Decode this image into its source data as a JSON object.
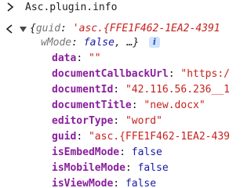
{
  "console": {
    "input": "Asc.plugin.info",
    "preview_line1": {
      "open": "{",
      "key1": "guid",
      "sep1": ": ",
      "val1": "'asc.{FFE1F462-1EA2-4391"
    },
    "preview_line2": {
      "key2": "wMode",
      "sep2": ": ",
      "val2": "false",
      "tail": ", …}"
    },
    "info_badge": "i",
    "properties": [
      {
        "key": "data",
        "sep": ": ",
        "value": "\"\"",
        "kind": "string"
      },
      {
        "key": "documentCallbackUrl",
        "sep": ": ",
        "value": "\"https:/",
        "kind": "string"
      },
      {
        "key": "documentId",
        "sep": ": ",
        "value": "\"42.116.56.236__1",
        "kind": "string"
      },
      {
        "key": "documentTitle",
        "sep": ": ",
        "value": "\"new.docx\"",
        "kind": "string"
      },
      {
        "key": "editorType",
        "sep": ": ",
        "value": "\"word\"",
        "kind": "string"
      },
      {
        "key": "guid",
        "sep": ": ",
        "value": "\"asc.{FFE1F462-1EA2-439",
        "kind": "string"
      },
      {
        "key": "isEmbedMode",
        "sep": ": ",
        "value": "false",
        "kind": "bool"
      },
      {
        "key": "isMobileMode",
        "sep": ": ",
        "value": "false",
        "kind": "bool"
      },
      {
        "key": "isViewMode",
        "sep": ": ",
        "value": "false",
        "kind": "bool"
      }
    ],
    "colors": {
      "key": "#891e9c",
      "string": "#c5221f",
      "keyword": "#1a1aa6",
      "arrow": "#1f1f1f"
    }
  }
}
